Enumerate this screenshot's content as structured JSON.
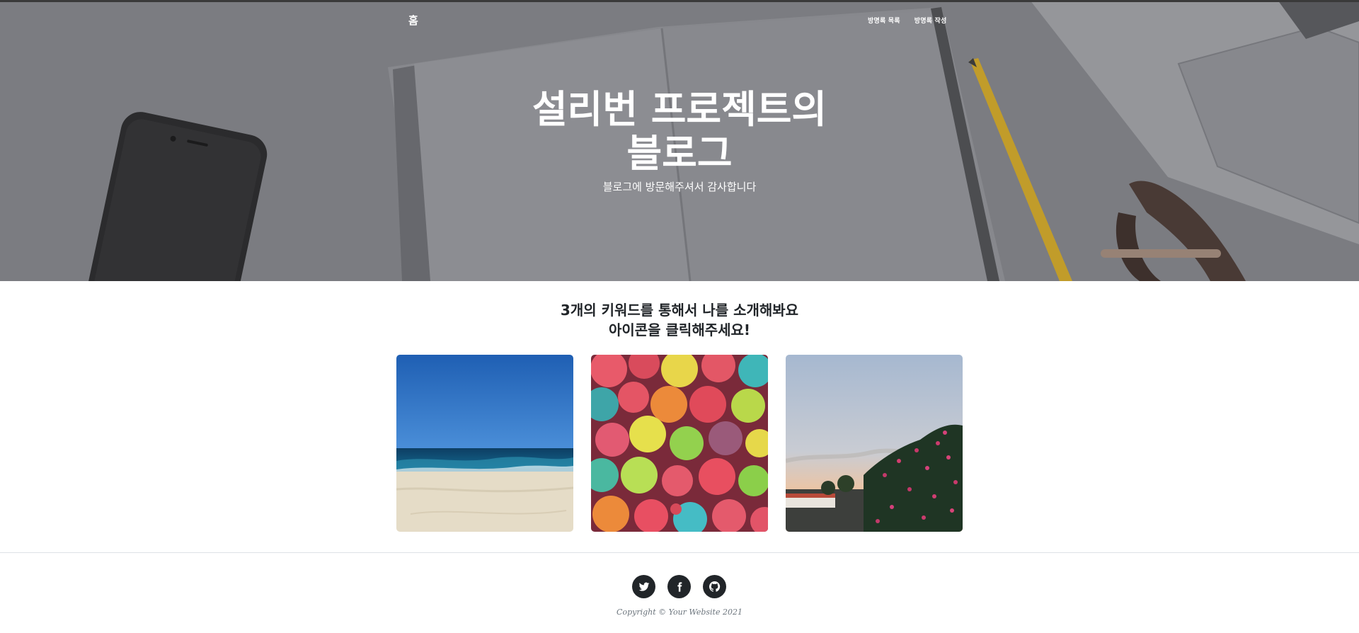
{
  "nav": {
    "brand": "홈",
    "links": [
      "방명록 목록",
      "방명록 작성"
    ]
  },
  "hero": {
    "title_line1": "설리번 프로젝트의",
    "title_line2": "블로그",
    "subtitle": "블로그에 방문해주셔서 감사합니다"
  },
  "intro": {
    "line1": "3개의 키워드를 통해서 나를 소개해봐요",
    "line2": "아이콘을 클릭해주세요!"
  },
  "cards": [
    {
      "icon": "beach-photo"
    },
    {
      "icon": "cereal-photo"
    },
    {
      "icon": "sunset-flowers-photo"
    }
  ],
  "footer": {
    "socials": [
      "twitter-icon",
      "facebook-icon",
      "github-icon"
    ],
    "copyright": "Copyright © Your Website 2021"
  },
  "colors": {
    "footer_icon_bg": "#212529",
    "copyright": "#6c757d"
  }
}
